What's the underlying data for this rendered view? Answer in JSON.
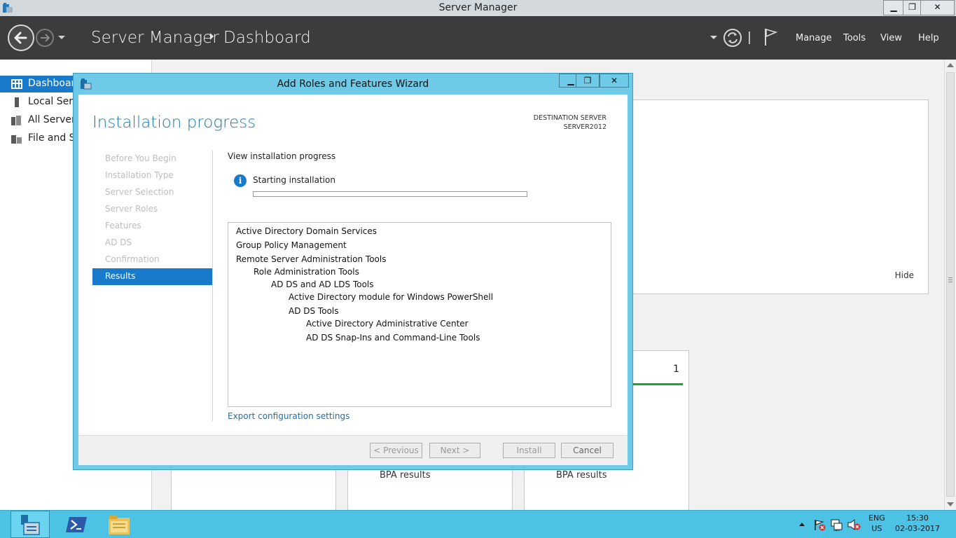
{
  "window": {
    "title": "Server Manager",
    "controls": {
      "minimize": "▁",
      "restore": "❐",
      "close": "✕"
    }
  },
  "header": {
    "app_name": "Server Manager",
    "page": "Dashboard",
    "menus": [
      "Manage",
      "Tools",
      "View",
      "Help"
    ]
  },
  "sidebar": {
    "items": [
      {
        "label": "Dashboard",
        "icon": "dashboard-icon",
        "selected": true
      },
      {
        "label": "Local Server",
        "icon": "server-icon",
        "selected": false
      },
      {
        "label": "All Servers",
        "icon": "servers-icon",
        "selected": false
      },
      {
        "label": "File and Storage Services",
        "icon": "storage-icon",
        "selected": false
      }
    ]
  },
  "background": {
    "hide_label": "Hide",
    "tile_count": "1",
    "bpa_label_1": "BPA results",
    "bpa_label_2": "BPA results"
  },
  "wizard": {
    "title": "Add Roles and Features Wizard",
    "controls": {
      "minimize": "▁",
      "restore": "❐",
      "close": "✕"
    },
    "heading": "Installation progress",
    "destination_label": "DESTINATION SERVER",
    "destination_server": "SERVER2012",
    "steps": [
      {
        "label": "Before You Begin",
        "active": false
      },
      {
        "label": "Installation Type",
        "active": false
      },
      {
        "label": "Server Selection",
        "active": false
      },
      {
        "label": "Server Roles",
        "active": false
      },
      {
        "label": "Features",
        "active": false
      },
      {
        "label": "AD DS",
        "active": false
      },
      {
        "label": "Confirmation",
        "active": false
      },
      {
        "label": "Results",
        "active": true
      }
    ],
    "view_progress_label": "View installation progress",
    "status": "Starting installation",
    "progress_fraction": 0.0,
    "features": [
      {
        "label": "Active Directory Domain Services",
        "level": 0
      },
      {
        "label": "Group Policy Management",
        "level": 0
      },
      {
        "label": "Remote Server Administration Tools",
        "level": 0
      },
      {
        "label": "Role Administration Tools",
        "level": 1
      },
      {
        "label": "AD DS and AD LDS Tools",
        "level": 2
      },
      {
        "label": "Active Directory module for Windows PowerShell",
        "level": 3
      },
      {
        "label": "AD DS Tools",
        "level": 3
      },
      {
        "label": "Active Directory Administrative Center",
        "level": 4
      },
      {
        "label": "AD DS Snap-Ins and Command-Line Tools",
        "level": 4
      }
    ],
    "export_link": "Export configuration settings",
    "buttons": {
      "previous": "< Previous",
      "next": "Next >",
      "install": "Install",
      "cancel": "Cancel"
    }
  },
  "taskbar": {
    "apps": [
      "server-manager-icon",
      "powershell-icon",
      "file-explorer-icon"
    ],
    "language": "ENG",
    "region": "US",
    "time": "15:30",
    "date": "02-03-2017"
  },
  "colors": {
    "accent": "#1979ca",
    "header_bg": "#3c3c3c",
    "wizard_frame": "#6ecae6",
    "taskbar": "#4cc2e4",
    "heading_blue": "#1e7aa8",
    "success_green": "#06b025"
  }
}
